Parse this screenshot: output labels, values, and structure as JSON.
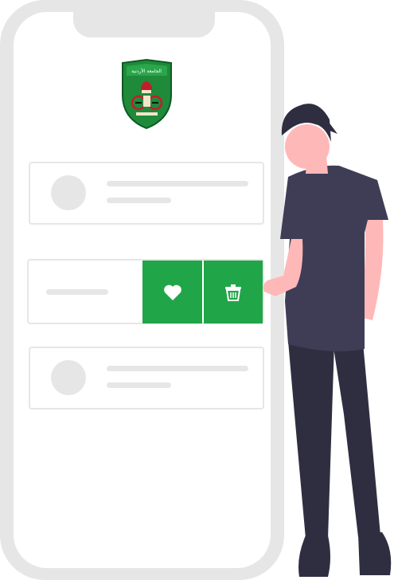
{
  "logo": {
    "name": "university-of-jordan-crest",
    "text": "الجامعة الأردنية"
  },
  "colors": {
    "accent": "#20a648",
    "frame": "#e6e6e6",
    "skin": "#ffb8b8",
    "shirt": "#3f3d56",
    "dark": "#2f2e41"
  },
  "actions": [
    {
      "name": "favorite",
      "icon": "heart-icon"
    },
    {
      "name": "delete",
      "icon": "trash-icon"
    }
  ]
}
